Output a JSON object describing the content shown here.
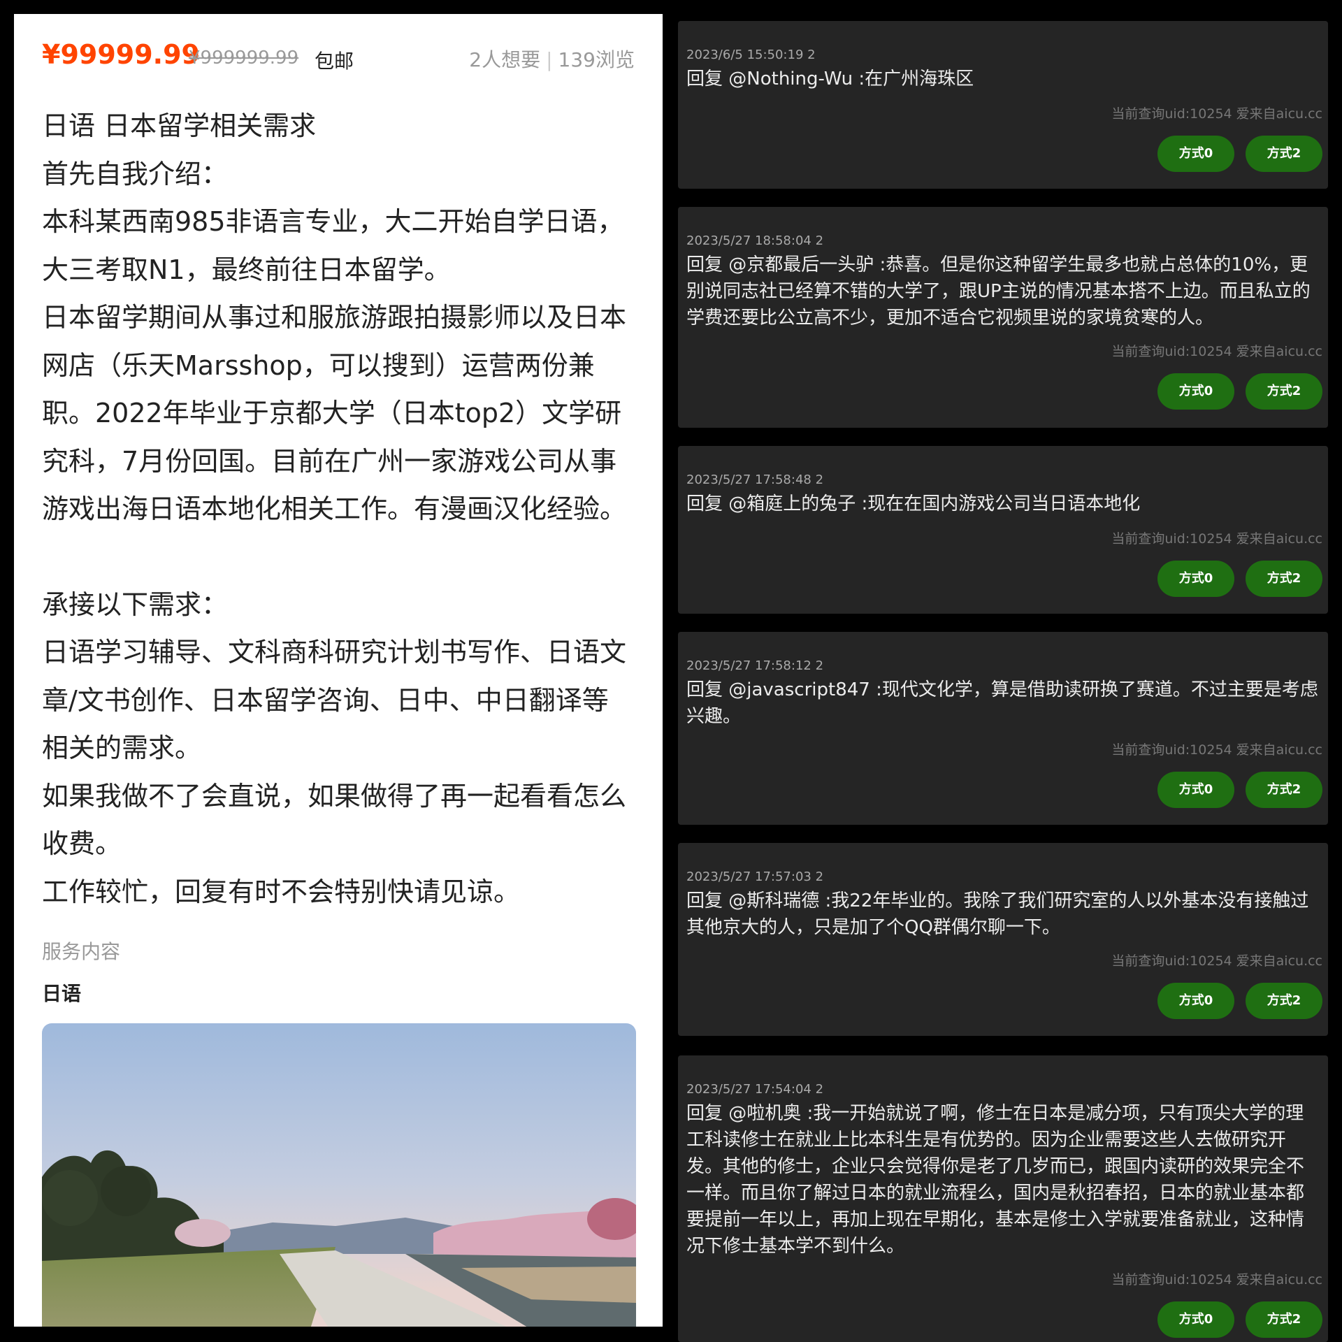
{
  "listing": {
    "price": "¥99999.99",
    "original_price": "¥999999.99",
    "shipping": "包邮",
    "wants": "2人想要",
    "views": "139浏览",
    "description_lines": [
      "日语 日本留学相关需求",
      "首先自我介绍：",
      "本科某西南985非语言专业，大二开始自学日语，",
      "大三考取N1，最终前往日本留学。",
      "日本留学期间从事过和服旅游跟拍摄影师以及日本",
      "网店（乐天Marsshop，可以搜到）运营两份兼",
      "职。2022年毕业于京都大学（日本top2）文学研",
      "究科，7月份回国。目前在广州一家游戏公司从事",
      "游戏出海日语本地化相关工作。有漫画汉化经验。",
      "",
      "承接以下需求：",
      "日语学习辅导、文科商科研究计划书写作、日语文",
      "章/文书创作、日本留学咨询、日中、中日翻译等",
      "相关的需求。",
      "如果我做不了会直说，如果做得了再一起看看怎么",
      "收费。",
      "工作较忙，回复有时不会特别快请见谅。"
    ],
    "service_label": "服务内容",
    "service_value": "日语"
  },
  "comments": [
    {
      "meta": "2023/6/5 15:50:19 2",
      "text": "回复 @Nothing-Wu :在广州海珠区",
      "note": "当前查询uid:10254 爱来自aicu.cc",
      "btn0": "方式0",
      "btn2": "方式2"
    },
    {
      "meta": "2023/5/27 18:58:04 2",
      "text": "回复 @京都最后一头驴 :恭喜。但是你这种留学生最多也就占总体的10%，更别说同志社已经算不错的大学了，跟UP主说的情况基本搭不上边。而且私立的学费还要比公立高不少，更加不适合它视频里说的家境贫寒的人。",
      "note": "当前查询uid:10254 爱来自aicu.cc",
      "btn0": "方式0",
      "btn2": "方式2"
    },
    {
      "meta": "2023/5/27 17:58:48 2",
      "text": "回复 @箱庭上的兔子 :现在在国内游戏公司当日语本地化",
      "note": "当前查询uid:10254 爱来自aicu.cc",
      "btn0": "方式0",
      "btn2": "方式2"
    },
    {
      "meta": "2023/5/27 17:58:12 2",
      "text": "回复 @javascript847 :现代文化学，算是借助读研换了赛道。不过主要是考虑兴趣。",
      "note": "当前查询uid:10254 爱来自aicu.cc",
      "btn0": "方式0",
      "btn2": "方式2"
    },
    {
      "meta": "2023/5/27 17:57:03 2",
      "text": "回复 @斯科瑞德 :我22年毕业的。我除了我们研究室的人以外基本没有接触过其他京大的人，只是加了个QQ群偶尔聊一下。",
      "note": "当前查询uid:10254 爱来自aicu.cc",
      "btn0": "方式0",
      "btn2": "方式2"
    },
    {
      "meta": "2023/5/27 17:54:04 2",
      "text": "回复 @啦机奥 :我一开始就说了啊，修士在日本是减分项，只有顶尖大学的理工科读修士在就业上比本科生是有优势的。因为企业需要这些人去做研究开发。其他的修士，企业只会觉得你是老了几岁而已，跟国内读研的效果完全不一样。而且你了解过日本的就业流程么，国内是秋招春招，日本的就业基本都要提前一年以上，再加上现在早期化，基本是修士入学就要准备就业，这种情况下修士基本学不到什么。",
      "note": "当前查询uid:10254 爱来自aicu.cc",
      "btn0": "方式0",
      "btn2": "方式2"
    }
  ],
  "colors": {
    "price": "#ff4400",
    "card_bg": "#252525",
    "button_green": "#1f6f12"
  }
}
